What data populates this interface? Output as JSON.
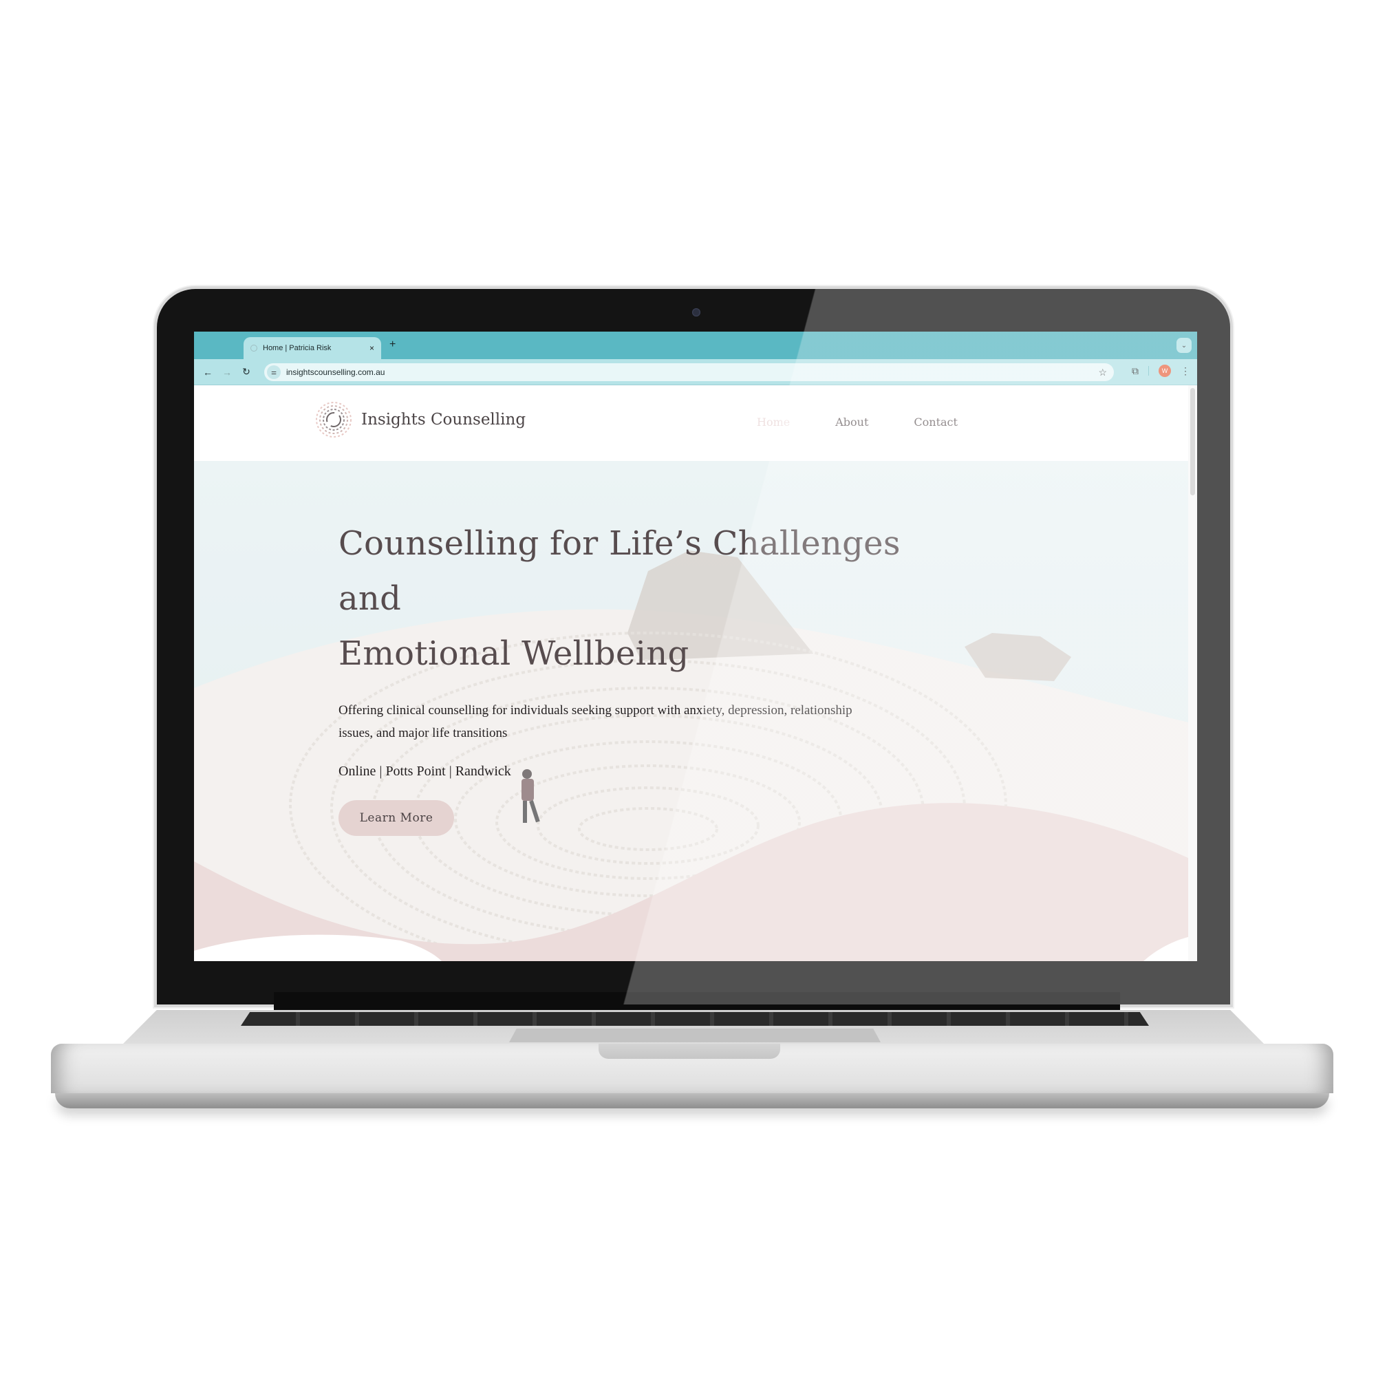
{
  "browser": {
    "tab": {
      "title": "Home | Patricia Risk",
      "close_icon": "×"
    },
    "new_tab_icon": "+",
    "tab_menu_icon": "⌄",
    "nav": {
      "back_icon": "←",
      "forward_icon": "→",
      "reload_icon": "↻"
    },
    "site_info_icon": "⚌",
    "url": "insightscounselling.com.au",
    "bookmark_icon": "☆",
    "extensions_icon": "⧉",
    "profile_initial": "W",
    "menu_icon": "⋮"
  },
  "site": {
    "logo_text": "Insights Counselling",
    "nav": [
      {
        "label": "Home",
        "active": true
      },
      {
        "label": "About",
        "active": false
      },
      {
        "label": "Contact",
        "active": false
      }
    ]
  },
  "hero": {
    "title_line1": "Counselling for Life’s Challenges and",
    "title_line2": "Emotional Wellbeing",
    "subtitle": "Offering clinical counselling for individuals seeking support with anxiety, depression, relationship issues, and major life transitions",
    "locations": "Online | Potts Point | Randwick",
    "cta_label": "Learn More"
  },
  "colors": {
    "tabstrip": "#5ab8c3",
    "toolbar": "#b5e3e7",
    "avatar": "#e8704f",
    "cta": "#e5d3d1",
    "wave": "#ecdcdb",
    "nav_active": "#efe1e1"
  }
}
